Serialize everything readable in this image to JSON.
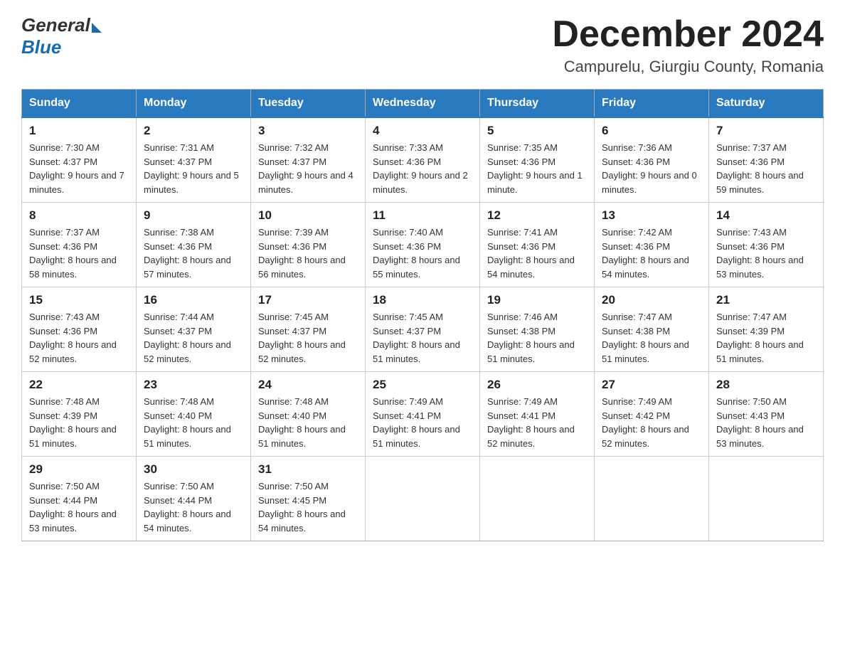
{
  "header": {
    "logo_general": "General",
    "logo_blue": "Blue",
    "month_year": "December 2024",
    "location": "Campurelu, Giurgiu County, Romania"
  },
  "weekdays": [
    "Sunday",
    "Monday",
    "Tuesday",
    "Wednesday",
    "Thursday",
    "Friday",
    "Saturday"
  ],
  "weeks": [
    [
      {
        "day": "1",
        "sunrise": "7:30 AM",
        "sunset": "4:37 PM",
        "daylight": "9 hours and 7 minutes."
      },
      {
        "day": "2",
        "sunrise": "7:31 AM",
        "sunset": "4:37 PM",
        "daylight": "9 hours and 5 minutes."
      },
      {
        "day": "3",
        "sunrise": "7:32 AM",
        "sunset": "4:37 PM",
        "daylight": "9 hours and 4 minutes."
      },
      {
        "day": "4",
        "sunrise": "7:33 AM",
        "sunset": "4:36 PM",
        "daylight": "9 hours and 2 minutes."
      },
      {
        "day": "5",
        "sunrise": "7:35 AM",
        "sunset": "4:36 PM",
        "daylight": "9 hours and 1 minute."
      },
      {
        "day": "6",
        "sunrise": "7:36 AM",
        "sunset": "4:36 PM",
        "daylight": "9 hours and 0 minutes."
      },
      {
        "day": "7",
        "sunrise": "7:37 AM",
        "sunset": "4:36 PM",
        "daylight": "8 hours and 59 minutes."
      }
    ],
    [
      {
        "day": "8",
        "sunrise": "7:37 AM",
        "sunset": "4:36 PM",
        "daylight": "8 hours and 58 minutes."
      },
      {
        "day": "9",
        "sunrise": "7:38 AM",
        "sunset": "4:36 PM",
        "daylight": "8 hours and 57 minutes."
      },
      {
        "day": "10",
        "sunrise": "7:39 AM",
        "sunset": "4:36 PM",
        "daylight": "8 hours and 56 minutes."
      },
      {
        "day": "11",
        "sunrise": "7:40 AM",
        "sunset": "4:36 PM",
        "daylight": "8 hours and 55 minutes."
      },
      {
        "day": "12",
        "sunrise": "7:41 AM",
        "sunset": "4:36 PM",
        "daylight": "8 hours and 54 minutes."
      },
      {
        "day": "13",
        "sunrise": "7:42 AM",
        "sunset": "4:36 PM",
        "daylight": "8 hours and 54 minutes."
      },
      {
        "day": "14",
        "sunrise": "7:43 AM",
        "sunset": "4:36 PM",
        "daylight": "8 hours and 53 minutes."
      }
    ],
    [
      {
        "day": "15",
        "sunrise": "7:43 AM",
        "sunset": "4:36 PM",
        "daylight": "8 hours and 52 minutes."
      },
      {
        "day": "16",
        "sunrise": "7:44 AM",
        "sunset": "4:37 PM",
        "daylight": "8 hours and 52 minutes."
      },
      {
        "day": "17",
        "sunrise": "7:45 AM",
        "sunset": "4:37 PM",
        "daylight": "8 hours and 52 minutes."
      },
      {
        "day": "18",
        "sunrise": "7:45 AM",
        "sunset": "4:37 PM",
        "daylight": "8 hours and 51 minutes."
      },
      {
        "day": "19",
        "sunrise": "7:46 AM",
        "sunset": "4:38 PM",
        "daylight": "8 hours and 51 minutes."
      },
      {
        "day": "20",
        "sunrise": "7:47 AM",
        "sunset": "4:38 PM",
        "daylight": "8 hours and 51 minutes."
      },
      {
        "day": "21",
        "sunrise": "7:47 AM",
        "sunset": "4:39 PM",
        "daylight": "8 hours and 51 minutes."
      }
    ],
    [
      {
        "day": "22",
        "sunrise": "7:48 AM",
        "sunset": "4:39 PM",
        "daylight": "8 hours and 51 minutes."
      },
      {
        "day": "23",
        "sunrise": "7:48 AM",
        "sunset": "4:40 PM",
        "daylight": "8 hours and 51 minutes."
      },
      {
        "day": "24",
        "sunrise": "7:48 AM",
        "sunset": "4:40 PM",
        "daylight": "8 hours and 51 minutes."
      },
      {
        "day": "25",
        "sunrise": "7:49 AM",
        "sunset": "4:41 PM",
        "daylight": "8 hours and 51 minutes."
      },
      {
        "day": "26",
        "sunrise": "7:49 AM",
        "sunset": "4:41 PM",
        "daylight": "8 hours and 52 minutes."
      },
      {
        "day": "27",
        "sunrise": "7:49 AM",
        "sunset": "4:42 PM",
        "daylight": "8 hours and 52 minutes."
      },
      {
        "day": "28",
        "sunrise": "7:50 AM",
        "sunset": "4:43 PM",
        "daylight": "8 hours and 53 minutes."
      }
    ],
    [
      {
        "day": "29",
        "sunrise": "7:50 AM",
        "sunset": "4:44 PM",
        "daylight": "8 hours and 53 minutes."
      },
      {
        "day": "30",
        "sunrise": "7:50 AM",
        "sunset": "4:44 PM",
        "daylight": "8 hours and 54 minutes."
      },
      {
        "day": "31",
        "sunrise": "7:50 AM",
        "sunset": "4:45 PM",
        "daylight": "8 hours and 54 minutes."
      },
      null,
      null,
      null,
      null
    ]
  ]
}
